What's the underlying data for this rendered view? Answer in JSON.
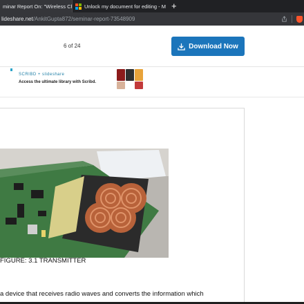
{
  "browser": {
    "tabs": [
      {
        "label": "minar Report On: \"Wireless Charg"
      },
      {
        "label": "Unlock my document for editing - Mic"
      }
    ],
    "new_tab_label": "+",
    "url_host": "lideshare.net",
    "url_path": "/AnkitGupta872/seminar-report-73548909"
  },
  "viewer": {
    "page_count": "6 of 24",
    "download_label": "Download Now"
  },
  "ad": {
    "brand": "SCRIBD + slideshare",
    "text": "Access the ultimate library with Scribd."
  },
  "document": {
    "caption": "FIGURE: 3.1 TRANSMITTER",
    "body_line": "a device that receives radio waves and converts the information which"
  },
  "colors": {
    "accent": "#1b75bb",
    "tab_bar": "#202124",
    "address_bar": "#35363a"
  }
}
